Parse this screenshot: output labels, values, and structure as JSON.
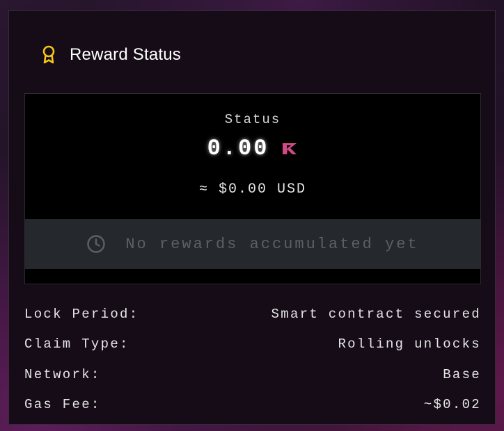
{
  "card": {
    "title": "Reward Status",
    "title_icon": "award-ribbon-icon",
    "accent_color": "#f5c518"
  },
  "status_panel": {
    "label": "Status",
    "amount": "0.00",
    "token_icon": "token-logo-icon",
    "token_color": "#d14a86",
    "usd_value": "≈ $0.00 USD",
    "notice": {
      "icon": "clock-icon",
      "text": "No rewards accumulated yet"
    }
  },
  "details": [
    {
      "label": "Lock Period:",
      "value": "Smart contract secured"
    },
    {
      "label": "Claim Type:",
      "value": "Rolling unlocks"
    },
    {
      "label": "Network:",
      "value": "Base"
    },
    {
      "label": "Gas Fee:",
      "value": "~$0.02"
    }
  ]
}
